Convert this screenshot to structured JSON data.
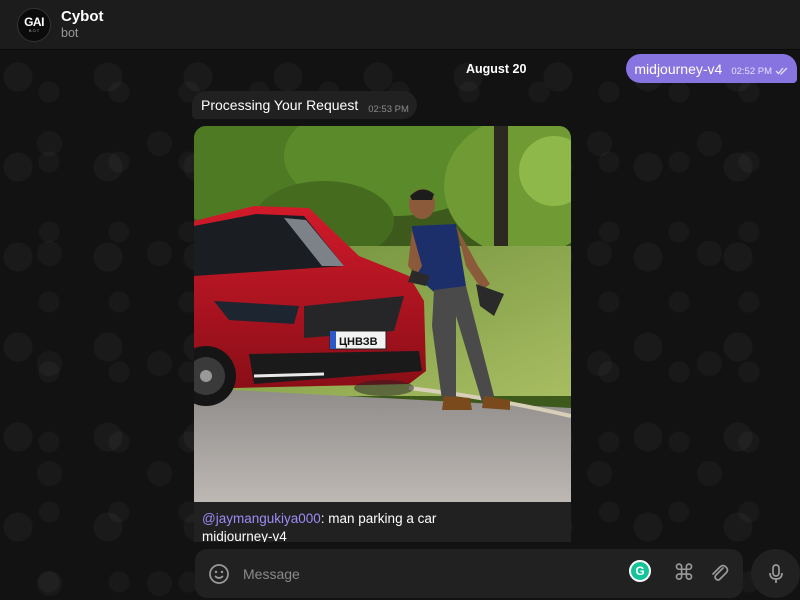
{
  "header": {
    "avatar_text": "GAI",
    "avatar_sub": "B O T",
    "title": "Cybot",
    "subtitle": "bot"
  },
  "messages": {
    "date_label": "August 20",
    "outgoing": {
      "text": "midjourney-v4",
      "time": "02:52 PM",
      "status_icon": "double-check-icon"
    },
    "incoming": {
      "text": "Processing Your Request",
      "time": "02:53 PM"
    },
    "media": {
      "image_icon": "generated-image",
      "caption_mention": "@jaymangukiya000",
      "caption_text": ": man parking a car",
      "caption_line2": "midjourney-v4"
    }
  },
  "composer": {
    "placeholder": "Message",
    "value": "",
    "icons": [
      "emoji-icon",
      "grammarly-icon",
      "command-icon",
      "attach-icon",
      "microphone-icon"
    ]
  },
  "colors": {
    "accent": "#8774e1",
    "mention": "#9d8cf5",
    "bubble": "#212121",
    "header": "#1c1c1d"
  }
}
